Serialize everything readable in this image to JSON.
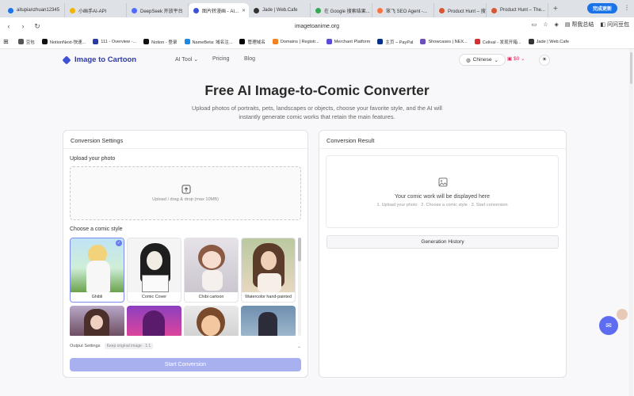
{
  "browser": {
    "tabs": [
      {
        "label": "aitupianzhuan12345",
        "color": "#1a73e8"
      },
      {
        "label": "小画手AI-API",
        "color": "#f4b400"
      },
      {
        "label": "DeepSeek 开放平台",
        "color": "#4d6bfe"
      },
      {
        "label": "图片转漫画 - AI...",
        "color": "#3f51d6"
      },
      {
        "label": "Jade | Web.Cafe",
        "color": "#333333"
      },
      {
        "label": "在 Google 搜索结果...",
        "color": "#34a853"
      },
      {
        "label": "笨飞 SEO Agent -...",
        "color": "#ff7043"
      },
      {
        "label": "Product Hunt – 搜索",
        "color": "#da552f"
      },
      {
        "label": "Product Hunt – The...",
        "color": "#da552f"
      }
    ],
    "update_label": "完成更新",
    "url": "imagetoanime.org",
    "addr_right": [
      "帮我总结",
      "问问豆包"
    ],
    "bookmarks": [
      {
        "label": "豆包",
        "color": "#555555"
      },
      {
        "label": "NotionNext-快速...",
        "color": "#111111"
      },
      {
        "label": "111 - Overview -...",
        "color": "#2b3aa8"
      },
      {
        "label": "Notion - 登录",
        "color": "#111111"
      },
      {
        "label": "NameBeta: 域名注...",
        "color": "#1e88e5"
      },
      {
        "label": "管理域名",
        "color": "#000000"
      },
      {
        "label": "Domains | Registr...",
        "color": "#f48120"
      },
      {
        "label": "Merchant Platform",
        "color": "#5b4bd6"
      },
      {
        "label": "主页 – PayPal",
        "color": "#003087"
      },
      {
        "label": "Showcases | NEX...",
        "color": "#6b4fbb"
      },
      {
        "label": "Celival - 发现开箱...",
        "color": "#d32f2f"
      },
      {
        "label": "Jade | Web.Cafe",
        "color": "#333333"
      }
    ]
  },
  "site": {
    "logo": "Image to Cartoon",
    "nav": [
      "AI Tool",
      "Pricing",
      "Blog"
    ],
    "language": "Chinese",
    "credits": "$0",
    "title": "Free AI Image-to-Comic Converter",
    "subtitle": "Upload photos of portraits, pets, landscapes or objects, choose your favorite style, and the AI will instantly generate comic works that retain the main features."
  },
  "settings": {
    "title": "Conversion Settings",
    "upload_label": "Upload your photo",
    "upload_hint": "Upload / drag & drop (max 10MB)",
    "style_label": "Choose a comic style",
    "styles": [
      "Ghibli",
      "Comic Cover",
      "Chibi cartoon",
      "Watercolor hand-painted"
    ],
    "output_label": "Output Settings",
    "output_badge": "Keep original image · 1:1",
    "start_label": "Start Conversion"
  },
  "result": {
    "title": "Conversion Result",
    "placeholder": "Your comic work will be displayed here",
    "steps": "1. Upload your photo · 2. Choose a comic style · 3. Start conversion",
    "history_label": "Generation History"
  }
}
